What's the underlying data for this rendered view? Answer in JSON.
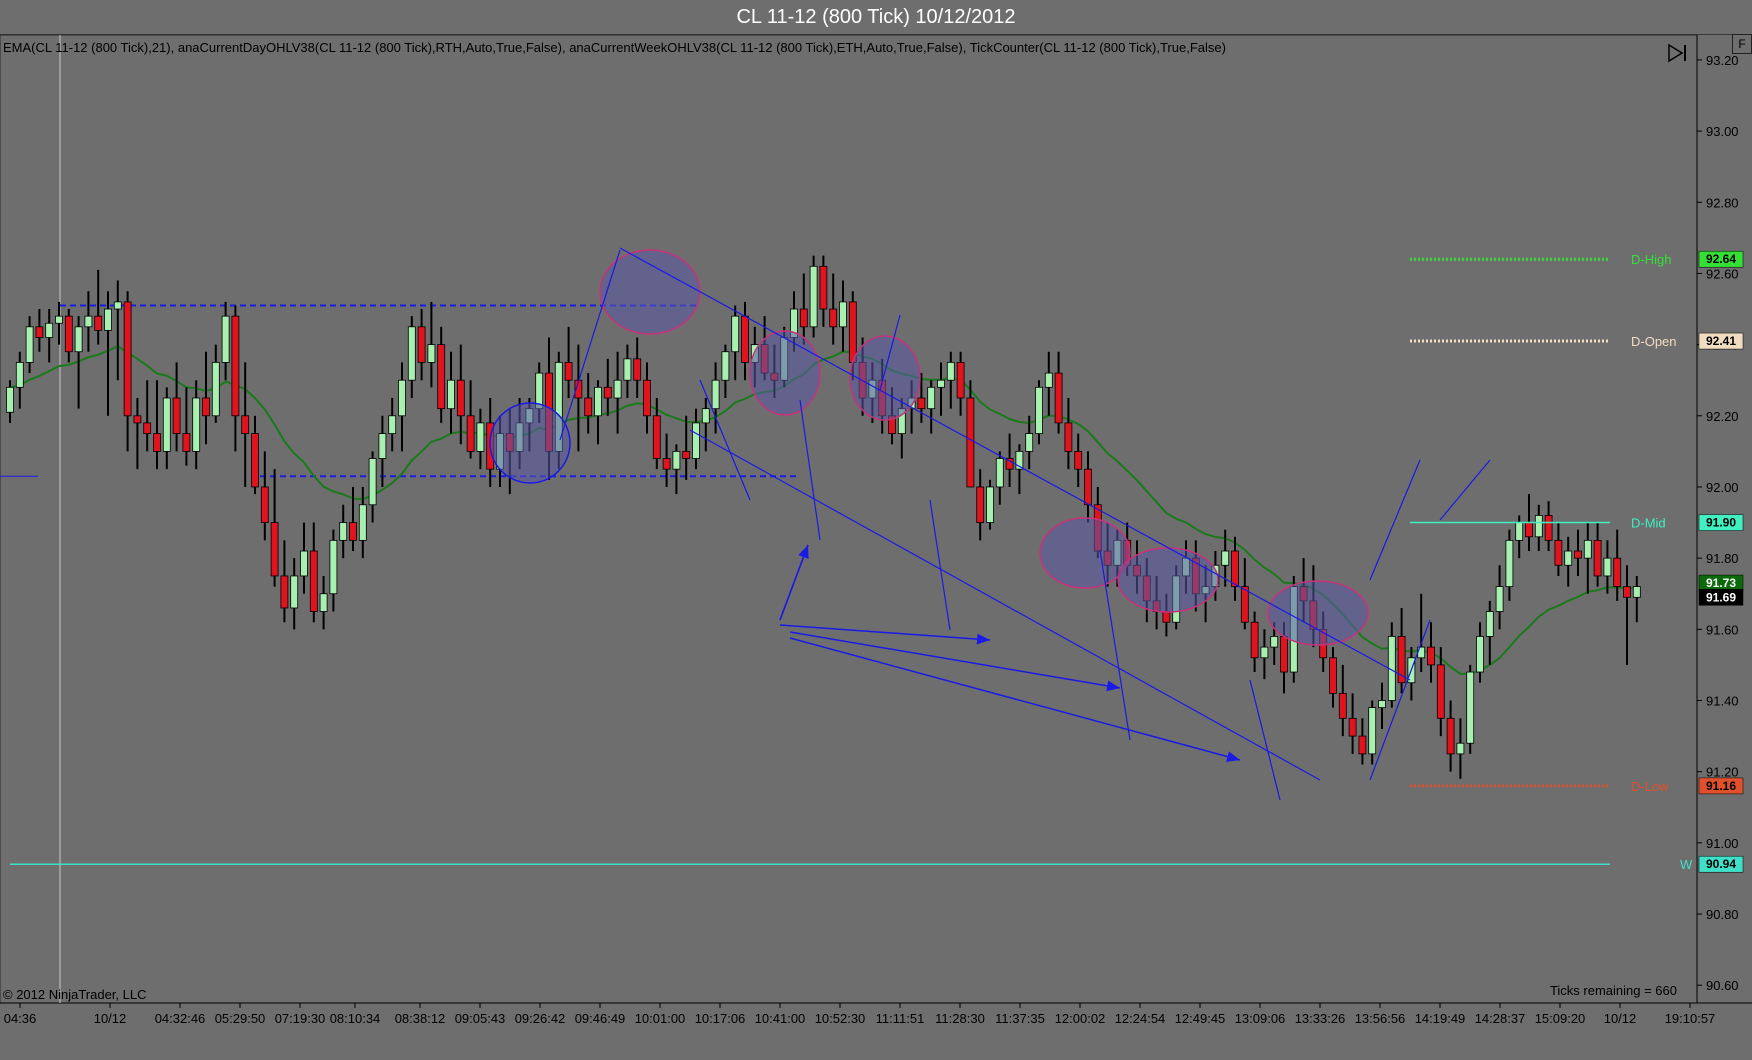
{
  "window": {
    "title": "CL 11-12 (800 Tick)  10/12/2012"
  },
  "indicators_text": "EMA(CL  11-12  (800  Tick),21),  anaCurrentDayOHLV38(CL  11-12  (800  Tick),RTH,Auto,True,False),  anaCurrentWeekOHLV38(CL  11-12  (800  Tick),ETH,Auto,True,False),  TickCounter(CL  11-12  (800  Tick),True,False)",
  "copyright": "© 2012 NinjaTrader, LLC",
  "ticks_remaining": "Ticks remaining = 660",
  "icons": {
    "nav": "skip-to-end-icon",
    "corner": "expand-icon"
  },
  "corner_button": "F",
  "colors": {
    "background": "#6e6e6e",
    "up_candle": "#a8f0b0",
    "down_candle": "#e0141e",
    "ema": "#1a7a1a",
    "drawings": "#1a1ae6",
    "ellipse_fill": "#5a5aa8",
    "ellipse_stroke": "#c8327a",
    "d_high": "#35e035",
    "d_open": "#f0dcc0",
    "d_mid": "#40f0c0",
    "d_low": "#e0502a",
    "w_low": "#40e0c8"
  },
  "chart_data": {
    "type": "candlestick",
    "instrument": "CL 11-12",
    "bar_type": "800 Tick",
    "date": "10/12/2012",
    "ylim": [
      90.55,
      93.27
    ],
    "yticks": [
      "93.20",
      "93.00",
      "92.80",
      "92.60",
      "92.40",
      "92.20",
      "92.00",
      "91.80",
      "91.60",
      "91.40",
      "91.20",
      "91.00",
      "90.80",
      "90.60"
    ],
    "time_labels": [
      "04:36",
      "10/12",
      "04:32:46",
      "05:29:50",
      "07:19:30",
      "08:10:34",
      "08:38:12",
      "09:05:43",
      "09:26:42",
      "09:46:49",
      "10:01:00",
      "10:17:06",
      "10:41:00",
      "10:52:30",
      "11:11:51",
      "11:28:30",
      "11:37:35",
      "12:00:02",
      "12:24:54",
      "12:49:45",
      "13:09:06",
      "13:33:26",
      "13:56:56",
      "14:19:49",
      "14:28:37",
      "15:09:20",
      "10/12",
      "19:10:57"
    ],
    "bar_count": 160,
    "levels": [
      {
        "name": "D-High",
        "label": "D-High",
        "value": 92.64,
        "box": "92.64",
        "style": "dotted"
      },
      {
        "name": "D-Open",
        "label": "D-Open",
        "value": 92.41,
        "box": "92.41",
        "style": "dotted"
      },
      {
        "name": "D-Mid",
        "label": "D-Mid",
        "value": 91.9,
        "box": "91.90",
        "style": "solid"
      },
      {
        "name": "D-Low",
        "label": "D-Low",
        "value": 91.16,
        "box": "91.16",
        "style": "dotted"
      },
      {
        "name": "W-Low",
        "label": "W",
        "value": 90.94,
        "box": "90.94",
        "style": "solid"
      }
    ],
    "last_price": "91.69",
    "ema_value": "91.73",
    "candles": [
      [
        92.21,
        92.3,
        92.18,
        92.28
      ],
      [
        92.28,
        92.38,
        92.22,
        92.35
      ],
      [
        92.35,
        92.48,
        92.32,
        92.45
      ],
      [
        92.45,
        92.5,
        92.38,
        92.42
      ],
      [
        92.42,
        92.5,
        92.35,
        92.46
      ],
      [
        92.46,
        92.52,
        92.4,
        92.48
      ],
      [
        92.48,
        92.5,
        92.35,
        92.38
      ],
      [
        92.38,
        92.48,
        92.22,
        92.45
      ],
      [
        92.45,
        92.55,
        92.38,
        92.48
      ],
      [
        92.48,
        92.61,
        92.4,
        92.44
      ],
      [
        92.44,
        92.55,
        92.2,
        92.5
      ],
      [
        92.5,
        92.58,
        92.3,
        92.52
      ],
      [
        92.52,
        92.55,
        92.1,
        92.2
      ],
      [
        92.2,
        92.25,
        92.05,
        92.18
      ],
      [
        92.18,
        92.3,
        92.1,
        92.15
      ],
      [
        92.15,
        92.3,
        92.05,
        92.1
      ],
      [
        92.1,
        92.28,
        92.05,
        92.25
      ],
      [
        92.25,
        92.35,
        92.1,
        92.15
      ],
      [
        92.15,
        92.28,
        92.06,
        92.1
      ],
      [
        92.1,
        92.3,
        92.05,
        92.25
      ],
      [
        92.25,
        92.38,
        92.12,
        92.2
      ],
      [
        92.2,
        92.4,
        92.18,
        92.35
      ],
      [
        92.35,
        92.52,
        92.3,
        92.48
      ],
      [
        92.48,
        92.51,
        92.1,
        92.2
      ],
      [
        92.2,
        92.35,
        92.0,
        92.15
      ],
      [
        92.15,
        92.2,
        91.98,
        92.0
      ],
      [
        92.0,
        92.1,
        91.85,
        91.9
      ],
      [
        91.9,
        92.05,
        91.72,
        91.75
      ],
      [
        91.75,
        91.85,
        91.62,
        91.66
      ],
      [
        91.66,
        91.8,
        91.6,
        91.75
      ],
      [
        91.75,
        91.9,
        91.7,
        91.82
      ],
      [
        91.82,
        91.9,
        91.62,
        91.65
      ],
      [
        91.65,
        91.75,
        91.6,
        91.7
      ],
      [
        91.7,
        91.88,
        91.65,
        91.85
      ],
      [
        91.85,
        91.95,
        91.8,
        91.9
      ],
      [
        91.9,
        92.0,
        91.82,
        91.85
      ],
      [
        91.85,
        92.0,
        91.8,
        91.95
      ],
      [
        91.95,
        92.1,
        91.9,
        92.08
      ],
      [
        92.08,
        92.2,
        92.0,
        92.15
      ],
      [
        92.15,
        92.25,
        92.1,
        92.2
      ],
      [
        92.2,
        92.35,
        92.1,
        92.3
      ],
      [
        92.3,
        92.48,
        92.25,
        92.45
      ],
      [
        92.45,
        92.5,
        92.3,
        92.35
      ],
      [
        92.35,
        92.52,
        92.28,
        92.4
      ],
      [
        92.4,
        92.45,
        92.18,
        92.22
      ],
      [
        92.22,
        92.38,
        92.15,
        92.3
      ],
      [
        92.3,
        92.4,
        92.12,
        92.2
      ],
      [
        92.2,
        92.3,
        92.08,
        92.1
      ],
      [
        92.1,
        92.22,
        92.05,
        92.18
      ],
      [
        92.18,
        92.25,
        92.0,
        92.05
      ],
      [
        92.05,
        92.2,
        92.0,
        92.15
      ],
      [
        92.15,
        92.22,
        91.98,
        92.1
      ],
      [
        92.1,
        92.25,
        92.05,
        92.18
      ],
      [
        92.18,
        92.25,
        92.1,
        92.22
      ],
      [
        92.22,
        92.35,
        92.18,
        92.32
      ],
      [
        92.32,
        92.42,
        92.02,
        92.1
      ],
      [
        92.1,
        92.38,
        92.05,
        92.35
      ],
      [
        92.35,
        92.45,
        92.25,
        92.3
      ],
      [
        92.3,
        92.4,
        92.1,
        92.25
      ],
      [
        92.25,
        92.32,
        92.15,
        92.2
      ],
      [
        92.2,
        92.3,
        92.12,
        92.28
      ],
      [
        92.28,
        92.36,
        92.2,
        92.25
      ],
      [
        92.25,
        92.38,
        92.15,
        92.3
      ],
      [
        92.3,
        92.4,
        92.25,
        92.36
      ],
      [
        92.36,
        92.42,
        92.25,
        92.3
      ],
      [
        92.3,
        92.35,
        92.15,
        92.2
      ],
      [
        92.2,
        92.25,
        92.05,
        92.08
      ],
      [
        92.08,
        92.15,
        92.0,
        92.05
      ],
      [
        92.05,
        92.12,
        91.98,
        92.1
      ],
      [
        92.1,
        92.2,
        92.02,
        92.08
      ],
      [
        92.08,
        92.22,
        92.05,
        92.18
      ],
      [
        92.18,
        92.25,
        92.1,
        92.22
      ],
      [
        92.22,
        92.35,
        92.15,
        92.3
      ],
      [
        92.3,
        92.4,
        92.25,
        92.38
      ],
      [
        92.38,
        92.51,
        92.3,
        92.48
      ],
      [
        92.48,
        92.52,
        92.3,
        92.35
      ],
      [
        92.35,
        92.45,
        92.28,
        92.4
      ],
      [
        92.4,
        92.48,
        92.3,
        92.32
      ],
      [
        92.32,
        92.4,
        92.25,
        92.3
      ],
      [
        92.3,
        92.45,
        92.28,
        92.42
      ],
      [
        92.42,
        92.55,
        92.38,
        92.5
      ],
      [
        92.5,
        92.6,
        92.4,
        92.45
      ],
      [
        92.45,
        92.65,
        92.42,
        92.62
      ],
      [
        92.62,
        92.65,
        92.45,
        92.5
      ],
      [
        92.5,
        92.6,
        92.4,
        92.45
      ],
      [
        92.45,
        92.58,
        92.38,
        92.52
      ],
      [
        92.52,
        92.55,
        92.3,
        92.35
      ],
      [
        92.35,
        92.42,
        92.2,
        92.25
      ],
      [
        92.25,
        92.35,
        92.18,
        92.3
      ],
      [
        92.3,
        92.36,
        92.15,
        92.2
      ],
      [
        92.2,
        92.28,
        92.12,
        92.15
      ],
      [
        92.15,
        92.25,
        92.08,
        92.22
      ],
      [
        92.22,
        92.3,
        92.15,
        92.25
      ],
      [
        92.25,
        92.32,
        92.18,
        92.22
      ],
      [
        92.22,
        92.3,
        92.15,
        92.28
      ],
      [
        92.28,
        92.35,
        92.2,
        92.3
      ],
      [
        92.3,
        92.38,
        92.22,
        92.35
      ],
      [
        92.35,
        92.38,
        92.2,
        92.25
      ],
      [
        92.25,
        92.3,
        92.0,
        92.0
      ],
      [
        92.0,
        92.05,
        91.85,
        91.9
      ],
      [
        91.9,
        92.02,
        91.88,
        92.0
      ],
      [
        92.0,
        92.1,
        91.95,
        92.08
      ],
      [
        92.08,
        92.15,
        92.0,
        92.05
      ],
      [
        92.05,
        92.12,
        91.98,
        92.1
      ],
      [
        92.1,
        92.2,
        92.05,
        92.15
      ],
      [
        92.15,
        92.3,
        92.12,
        92.28
      ],
      [
        92.28,
        92.38,
        92.2,
        92.32
      ],
      [
        92.32,
        92.38,
        92.15,
        92.18
      ],
      [
        92.18,
        92.25,
        92.05,
        92.1
      ],
      [
        92.1,
        92.15,
        92.0,
        92.05
      ],
      [
        92.05,
        92.1,
        91.9,
        91.95
      ],
      [
        91.95,
        92.0,
        91.8,
        91.82
      ],
      [
        91.82,
        91.9,
        91.72,
        91.78
      ],
      [
        91.78,
        91.88,
        91.72,
        91.85
      ],
      [
        91.85,
        91.9,
        91.75,
        91.78
      ],
      [
        91.78,
        91.85,
        91.7,
        91.75
      ],
      [
        91.75,
        91.8,
        91.62,
        91.68
      ],
      [
        91.68,
        91.75,
        91.6,
        91.65
      ],
      [
        91.65,
        91.7,
        91.58,
        91.62
      ],
      [
        91.62,
        91.78,
        91.6,
        91.75
      ],
      [
        91.75,
        91.85,
        91.7,
        91.8
      ],
      [
        91.8,
        91.85,
        91.65,
        91.7
      ],
      [
        91.7,
        91.78,
        91.62,
        91.72
      ],
      [
        91.72,
        91.82,
        91.68,
        91.78
      ],
      [
        91.78,
        91.88,
        91.72,
        91.82
      ],
      [
        91.82,
        91.86,
        91.68,
        91.72
      ],
      [
        91.72,
        91.8,
        91.6,
        91.62
      ],
      [
        91.62,
        91.65,
        91.48,
        91.52
      ],
      [
        91.52,
        91.6,
        91.46,
        91.55
      ],
      [
        91.55,
        91.62,
        91.5,
        91.58
      ],
      [
        91.58,
        91.62,
        91.42,
        91.48
      ],
      [
        91.48,
        91.75,
        91.45,
        91.72
      ],
      [
        91.72,
        91.8,
        91.62,
        91.68
      ],
      [
        91.68,
        91.78,
        91.55,
        91.6
      ],
      [
        91.6,
        91.65,
        91.48,
        91.52
      ],
      [
        91.52,
        91.55,
        91.38,
        91.42
      ],
      [
        91.42,
        91.5,
        91.3,
        91.35
      ],
      [
        91.35,
        91.42,
        91.25,
        91.3
      ],
      [
        91.3,
        91.35,
        91.22,
        91.25
      ],
      [
        91.25,
        91.4,
        91.22,
        91.38
      ],
      [
        91.38,
        91.45,
        91.32,
        91.4
      ],
      [
        91.4,
        91.62,
        91.38,
        91.58
      ],
      [
        91.58,
        91.66,
        91.42,
        91.45
      ],
      [
        91.45,
        91.55,
        91.4,
        91.52
      ],
      [
        91.52,
        91.7,
        91.48,
        91.55
      ],
      [
        91.55,
        91.62,
        91.45,
        91.5
      ],
      [
        91.5,
        91.55,
        91.3,
        91.35
      ],
      [
        91.35,
        91.4,
        91.2,
        91.25
      ],
      [
        91.25,
        91.35,
        91.18,
        91.28
      ],
      [
        91.28,
        91.5,
        91.25,
        91.48
      ],
      [
        91.48,
        91.62,
        91.45,
        91.58
      ],
      [
        91.58,
        91.68,
        91.5,
        91.65
      ],
      [
        91.65,
        91.78,
        91.6,
        91.72
      ],
      [
        91.72,
        91.88,
        91.68,
        91.85
      ],
      [
        91.85,
        91.92,
        91.8,
        91.9
      ]
    ],
    "tail_candles": [
      [
        91.9,
        91.98,
        91.82,
        91.86
      ],
      [
        91.86,
        91.95,
        91.82,
        91.92
      ],
      [
        91.92,
        91.96,
        91.82,
        91.85
      ],
      [
        91.85,
        91.9,
        91.75,
        91.78
      ],
      [
        91.78,
        91.86,
        91.72,
        91.82
      ],
      [
        91.82,
        91.88,
        91.75,
        91.8
      ],
      [
        91.8,
        91.9,
        91.7,
        91.85
      ],
      [
        91.85,
        91.9,
        91.72,
        91.75
      ],
      [
        91.75,
        91.85,
        91.7,
        91.8
      ],
      [
        91.8,
        91.88,
        91.68,
        91.72
      ],
      [
        91.72,
        91.78,
        91.5,
        91.69
      ],
      [
        91.69,
        91.75,
        91.62,
        91.72
      ]
    ]
  }
}
